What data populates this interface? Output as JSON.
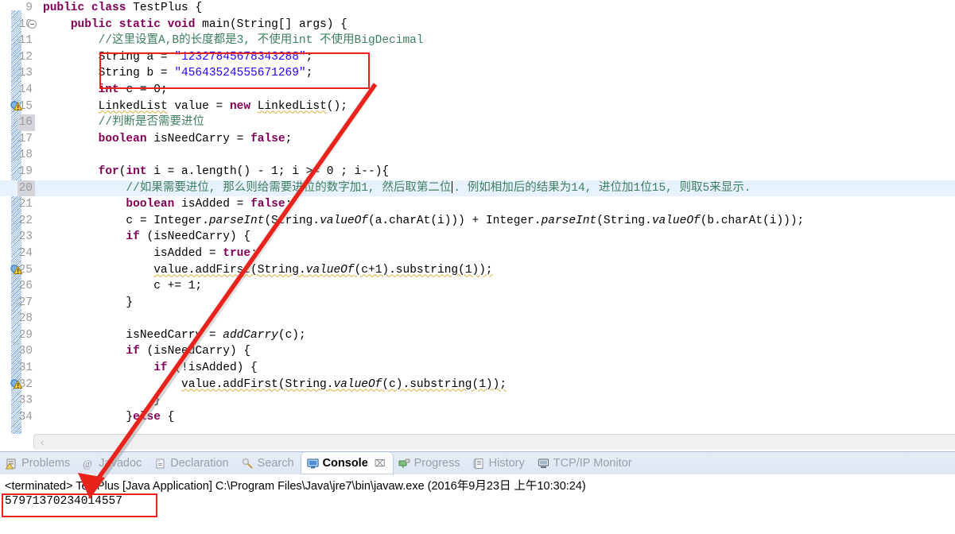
{
  "editor": {
    "lines": [
      {
        "num": "9",
        "indent": 0,
        "current": false,
        "numhl": false,
        "warn": false,
        "fold": false,
        "tokens": [
          {
            "t": "public ",
            "c": "kw"
          },
          {
            "t": "class ",
            "c": "kw"
          },
          {
            "t": "TestPlus {",
            "c": "plain"
          }
        ]
      },
      {
        "num": "10",
        "indent": 0,
        "current": false,
        "numhl": false,
        "warn": false,
        "fold": true,
        "tokens": [
          {
            "t": "    ",
            "c": "plain"
          },
          {
            "t": "public static void ",
            "c": "kw"
          },
          {
            "t": "main(String[] args) {",
            "c": "plain"
          }
        ]
      },
      {
        "num": "11",
        "indent": 0,
        "current": false,
        "numhl": false,
        "warn": false,
        "fold": false,
        "tokens": [
          {
            "t": "        ",
            "c": "plain"
          },
          {
            "t": "//这里设置A,B的长度都是3, 不使用int 不使用BigDecimal",
            "c": "cmt"
          }
        ]
      },
      {
        "num": "12",
        "indent": 0,
        "current": false,
        "numhl": false,
        "warn": false,
        "fold": false,
        "tokens": [
          {
            "t": "        String a = ",
            "c": "plain"
          },
          {
            "t": "\"12327845678343288\"",
            "c": "str"
          },
          {
            "t": ";",
            "c": "plain"
          }
        ]
      },
      {
        "num": "13",
        "indent": 0,
        "current": false,
        "numhl": false,
        "warn": false,
        "fold": false,
        "tokens": [
          {
            "t": "        String b = ",
            "c": "plain"
          },
          {
            "t": "\"45643524555671269\"",
            "c": "str"
          },
          {
            "t": ";",
            "c": "plain"
          }
        ]
      },
      {
        "num": "14",
        "indent": 0,
        "current": false,
        "numhl": false,
        "warn": false,
        "fold": false,
        "tokens": [
          {
            "t": "        ",
            "c": "plain"
          },
          {
            "t": "int ",
            "c": "kw"
          },
          {
            "t": "c = 0;",
            "c": "plain"
          }
        ]
      },
      {
        "num": "15",
        "indent": 0,
        "current": false,
        "numhl": false,
        "warn": true,
        "fold": false,
        "tokens": [
          {
            "t": "        ",
            "c": "plain"
          },
          {
            "t": "LinkedList",
            "c": "plain warn-underline"
          },
          {
            "t": " value = ",
            "c": "plain"
          },
          {
            "t": "new ",
            "c": "kw"
          },
          {
            "t": "LinkedList",
            "c": "plain warn-underline"
          },
          {
            "t": "();",
            "c": "plain"
          }
        ]
      },
      {
        "num": "16",
        "indent": 0,
        "current": false,
        "numhl": true,
        "warn": false,
        "fold": false,
        "tokens": [
          {
            "t": "        ",
            "c": "plain"
          },
          {
            "t": "//判断是否需要进位",
            "c": "cmt"
          }
        ]
      },
      {
        "num": "17",
        "indent": 0,
        "current": false,
        "numhl": false,
        "warn": false,
        "fold": false,
        "tokens": [
          {
            "t": "        ",
            "c": "plain"
          },
          {
            "t": "boolean ",
            "c": "kw"
          },
          {
            "t": "isNeedCarry = ",
            "c": "plain"
          },
          {
            "t": "false",
            "c": "kw"
          },
          {
            "t": ";",
            "c": "plain"
          }
        ]
      },
      {
        "num": "18",
        "indent": 0,
        "current": false,
        "numhl": false,
        "warn": false,
        "fold": false,
        "tokens": [
          {
            "t": "",
            "c": "plain"
          }
        ]
      },
      {
        "num": "19",
        "indent": 0,
        "current": false,
        "numhl": false,
        "warn": false,
        "fold": false,
        "tokens": [
          {
            "t": "        ",
            "c": "plain"
          },
          {
            "t": "for",
            "c": "kw"
          },
          {
            "t": "(",
            "c": "plain"
          },
          {
            "t": "int ",
            "c": "kw"
          },
          {
            "t": "i = a.length() - 1; i >= 0 ; i--){",
            "c": "plain"
          }
        ]
      },
      {
        "num": "20",
        "indent": 0,
        "current": true,
        "numhl": true,
        "warn": false,
        "fold": false,
        "caretAfter": 33,
        "tokens": [
          {
            "t": "            ",
            "c": "plain"
          },
          {
            "t": "//如果需要进位, 那么则给需要进位的数字加1, 然后取第二位",
            "c": "cmt"
          },
          {
            "t": "CARET",
            "c": "caret"
          },
          {
            "t": ". 例如相加后的结果为14, 进位加1位15, 则取5来显示.",
            "c": "cmt"
          }
        ]
      },
      {
        "num": "21",
        "indent": 0,
        "current": false,
        "numhl": false,
        "warn": false,
        "fold": false,
        "tokens": [
          {
            "t": "            ",
            "c": "plain"
          },
          {
            "t": "boolean ",
            "c": "kw"
          },
          {
            "t": "isAdded = ",
            "c": "plain"
          },
          {
            "t": "false",
            "c": "kw"
          },
          {
            "t": ";",
            "c": "plain"
          }
        ]
      },
      {
        "num": "22",
        "indent": 0,
        "current": false,
        "numhl": false,
        "warn": false,
        "fold": false,
        "tokens": [
          {
            "t": "            c = Integer.",
            "c": "plain"
          },
          {
            "t": "parseInt",
            "c": "ital"
          },
          {
            "t": "(String.",
            "c": "plain"
          },
          {
            "t": "valueOf",
            "c": "ital"
          },
          {
            "t": "(a.charAt(i))) + Integer.",
            "c": "plain"
          },
          {
            "t": "parseInt",
            "c": "ital"
          },
          {
            "t": "(String.",
            "c": "plain"
          },
          {
            "t": "valueOf",
            "c": "ital"
          },
          {
            "t": "(b.charAt(i)));",
            "c": "plain"
          }
        ]
      },
      {
        "num": "23",
        "indent": 0,
        "current": false,
        "numhl": false,
        "warn": false,
        "fold": false,
        "tokens": [
          {
            "t": "            ",
            "c": "plain"
          },
          {
            "t": "if ",
            "c": "kw"
          },
          {
            "t": "(isNeedCarry) {",
            "c": "plain"
          }
        ]
      },
      {
        "num": "24",
        "indent": 0,
        "current": false,
        "numhl": false,
        "warn": false,
        "fold": false,
        "tokens": [
          {
            "t": "                isAdded = ",
            "c": "plain"
          },
          {
            "t": "true",
            "c": "kw"
          },
          {
            "t": ";",
            "c": "plain"
          }
        ]
      },
      {
        "num": "25",
        "indent": 0,
        "current": false,
        "numhl": false,
        "warn": true,
        "fold": false,
        "tokens": [
          {
            "t": "                ",
            "c": "plain"
          },
          {
            "t": "value.addFirst(String.",
            "c": "plain warn-underline"
          },
          {
            "t": "valueOf",
            "c": "ital warn-underline"
          },
          {
            "t": "(c+1).substring(1));",
            "c": "plain warn-underline"
          }
        ]
      },
      {
        "num": "26",
        "indent": 0,
        "current": false,
        "numhl": false,
        "warn": false,
        "fold": false,
        "tokens": [
          {
            "t": "                c += 1;",
            "c": "plain"
          }
        ]
      },
      {
        "num": "27",
        "indent": 0,
        "current": false,
        "numhl": false,
        "warn": false,
        "fold": false,
        "tokens": [
          {
            "t": "            }",
            "c": "plain"
          }
        ]
      },
      {
        "num": "28",
        "indent": 0,
        "current": false,
        "numhl": false,
        "warn": false,
        "fold": false,
        "tokens": [
          {
            "t": "",
            "c": "plain"
          }
        ]
      },
      {
        "num": "29",
        "indent": 0,
        "current": false,
        "numhl": false,
        "warn": false,
        "fold": false,
        "tokens": [
          {
            "t": "            isNeedCarry = ",
            "c": "plain"
          },
          {
            "t": "addCarry",
            "c": "ital"
          },
          {
            "t": "(c);",
            "c": "plain"
          }
        ]
      },
      {
        "num": "30",
        "indent": 0,
        "current": false,
        "numhl": false,
        "warn": false,
        "fold": false,
        "tokens": [
          {
            "t": "            ",
            "c": "plain"
          },
          {
            "t": "if ",
            "c": "kw"
          },
          {
            "t": "(isNeedCarry) {",
            "c": "plain"
          }
        ]
      },
      {
        "num": "31",
        "indent": 0,
        "current": false,
        "numhl": false,
        "warn": false,
        "fold": false,
        "tokens": [
          {
            "t": "                ",
            "c": "plain"
          },
          {
            "t": "if ",
            "c": "kw"
          },
          {
            "t": "(!isAdded) {",
            "c": "plain"
          }
        ]
      },
      {
        "num": "32",
        "indent": 0,
        "current": false,
        "numhl": false,
        "warn": true,
        "fold": false,
        "tokens": [
          {
            "t": "                    ",
            "c": "plain"
          },
          {
            "t": "value.addFirst(String.",
            "c": "plain warn-underline"
          },
          {
            "t": "valueOf",
            "c": "ital warn-underline"
          },
          {
            "t": "(c).substring(1));",
            "c": "plain warn-underline"
          }
        ]
      },
      {
        "num": "33",
        "indent": 0,
        "current": false,
        "numhl": false,
        "warn": false,
        "fold": false,
        "tokens": [
          {
            "t": "                }",
            "c": "plain"
          }
        ]
      },
      {
        "num": "34",
        "indent": 0,
        "current": false,
        "numhl": false,
        "warn": false,
        "fold": false,
        "tokens": [
          {
            "t": "            }",
            "c": "plain"
          },
          {
            "t": "else ",
            "c": "kw"
          },
          {
            "t": "{",
            "c": "plain"
          }
        ]
      }
    ],
    "scrollbar_left_arrow": "‹"
  },
  "bottom_panel": {
    "tabs": [
      {
        "label": "Problems",
        "icon": "problems-icon",
        "active": false,
        "closable": false
      },
      {
        "label": "Javadoc",
        "icon": "javadoc-icon",
        "active": false,
        "closable": false
      },
      {
        "label": "Declaration",
        "icon": "declaration-icon",
        "active": false,
        "closable": false
      },
      {
        "label": "Search",
        "icon": "search-icon",
        "active": false,
        "closable": false
      },
      {
        "label": "Console",
        "icon": "console-icon",
        "active": true,
        "closable": true
      },
      {
        "label": "Progress",
        "icon": "progress-icon",
        "active": false,
        "closable": false
      },
      {
        "label": "History",
        "icon": "history-icon",
        "active": false,
        "closable": false
      },
      {
        "label": "TCP/IP Monitor",
        "icon": "tcpip-monitor-icon",
        "active": false,
        "closable": false
      }
    ],
    "close_glyph": "⌧",
    "launch_line": "<terminated> TestPlus [Java Application] C:\\Program Files\\Java\\jre7\\bin\\javaw.exe (2016年9月23日 上午10:30:24)",
    "console_output": "57971370234014557"
  },
  "annotations": {
    "accent_color": "#e8231b",
    "box_strings_label": "string-literals-highlight",
    "box_output_label": "console-output-highlight",
    "arrow_label": "annotation-arrow"
  }
}
